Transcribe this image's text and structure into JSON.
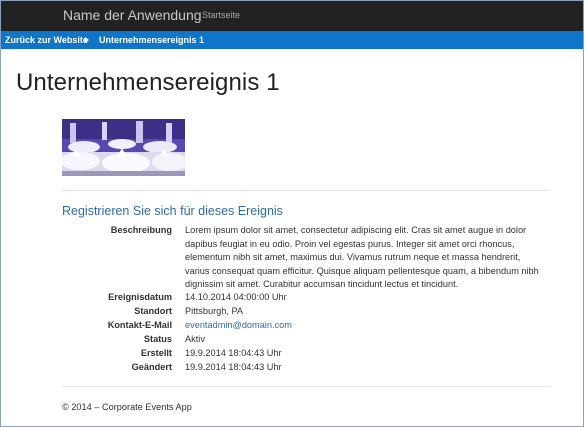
{
  "navbar": {
    "brand": "Name der Anwendung",
    "links": [
      "Startseite"
    ]
  },
  "breadcrumb": {
    "back_label": "Zurück zur Website",
    "current_label": "Unternehmensereignis 1"
  },
  "page": {
    "title": "Unternehmensereignis 1",
    "section_title": "Registrieren Sie sich für dieses Ereignis"
  },
  "details": {
    "description_label": "Beschreibung",
    "description_value": "Lorem ipsum dolor sit amet, consectetur adipiscing elit. Cras sit amet augue in dolor dapibus feugiat in eu odio. Proin vel egestas purus. Integer sit amet orci rhoncus, elementum nibh sit amet, maximus dui. Vivamus rutrum neque et massa hendrerit, varius consequat quam efficitur. Quisque aliquam pellentesque quam, a bibendum nibh dignissim sit amet. Curabitur accumsan tincidunt lectus et tincidunt.",
    "date_label": "Ereignisdatum",
    "date_value": "14.10.2014 04:00:00 Uhr",
    "location_label": "Standort",
    "location_value": "Pittsburgh, PA",
    "contact_label": "Kontakt-E-Mail",
    "contact_value": "eventadmin@domain.com",
    "status_label": "Status",
    "status_value": "Aktiv",
    "created_label": "Erstellt",
    "created_value": "19.9.2014 18:04:43 Uhr",
    "modified_label": "Geändert",
    "modified_value": "19.9.2014 18:04:43 Uhr"
  },
  "footer": {
    "text": "© 2014 – Corporate Events App"
  },
  "colors": {
    "navbar_bg": "#222222",
    "breadcrumb_bg": "#0e75c8",
    "link": "#2a6ebb",
    "section_title": "#2e6da4"
  }
}
